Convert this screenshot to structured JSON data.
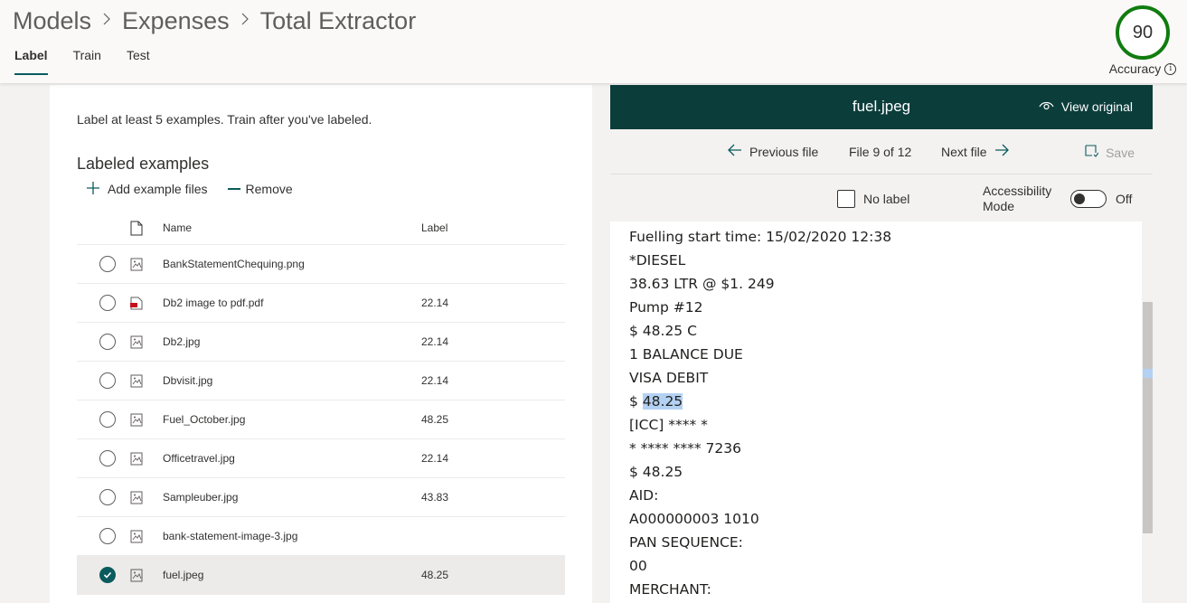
{
  "breadcrumb": [
    "Models",
    "Expenses",
    "Total Extractor"
  ],
  "tabs": [
    {
      "label": "Label",
      "active": true
    },
    {
      "label": "Train",
      "active": false
    },
    {
      "label": "Test",
      "active": false
    }
  ],
  "accuracy": {
    "value": "90",
    "label": "Accuracy",
    "info": "i"
  },
  "left": {
    "instruction": "Label at least 5 examples. Train after you've labeled.",
    "section_title": "Labeled examples",
    "add_label": "Add example files",
    "remove_label": "Remove",
    "columns": {
      "name": "Name",
      "label": "Label"
    },
    "rows": [
      {
        "name": "BankStatementChequing.png",
        "label": "",
        "type": "image",
        "selected": false
      },
      {
        "name": "Db2 image to pdf.pdf",
        "label": "22.14",
        "type": "pdf",
        "selected": false
      },
      {
        "name": "Db2.jpg",
        "label": "22.14",
        "type": "image",
        "selected": false
      },
      {
        "name": "Dbvisit.jpg",
        "label": "22.14",
        "type": "image",
        "selected": false
      },
      {
        "name": "Fuel_October.jpg",
        "label": "48.25",
        "type": "image",
        "selected": false
      },
      {
        "name": "Officetravel.jpg",
        "label": "22.14",
        "type": "image",
        "selected": false
      },
      {
        "name": "Sampleuber.jpg",
        "label": "43.83",
        "type": "image",
        "selected": false
      },
      {
        "name": "bank-statement-image-3.jpg",
        "label": "",
        "type": "image",
        "selected": false
      },
      {
        "name": "fuel.jpeg",
        "label": "48.25",
        "type": "image",
        "selected": true
      }
    ]
  },
  "viewer": {
    "title": "fuel.jpeg",
    "view_original": "View original",
    "previous": "Previous file",
    "file_count": "File 9 of 12",
    "next": "Next file",
    "save": "Save",
    "no_label": "No label",
    "accessibility_line1": "Accessibility",
    "accessibility_line2": "Mode",
    "toggle_state": "Off",
    "lines": [
      "Fuelling start time: 15/02/2020 12:38",
      "*DIESEL",
      "38.63 LTR @ $1. 249",
      "Pump #12",
      "$ 48.25 C",
      "1 BALANCE DUE",
      "VISA DEBIT",
      "$ ",
      "[ICC] **** *",
      "* **** **** 7236",
      "$ 48.25",
      "AID:",
      "A000000003 1010",
      "PAN SEQUENCE:",
      "00",
      "MERCHANT:"
    ],
    "highlight_text": "48.25"
  },
  "colors": {
    "accent": "#0b5b5e",
    "header_dark": "#0b3d3b",
    "accuracy_ring": "#107c10",
    "highlight": "#b3d1f2"
  }
}
